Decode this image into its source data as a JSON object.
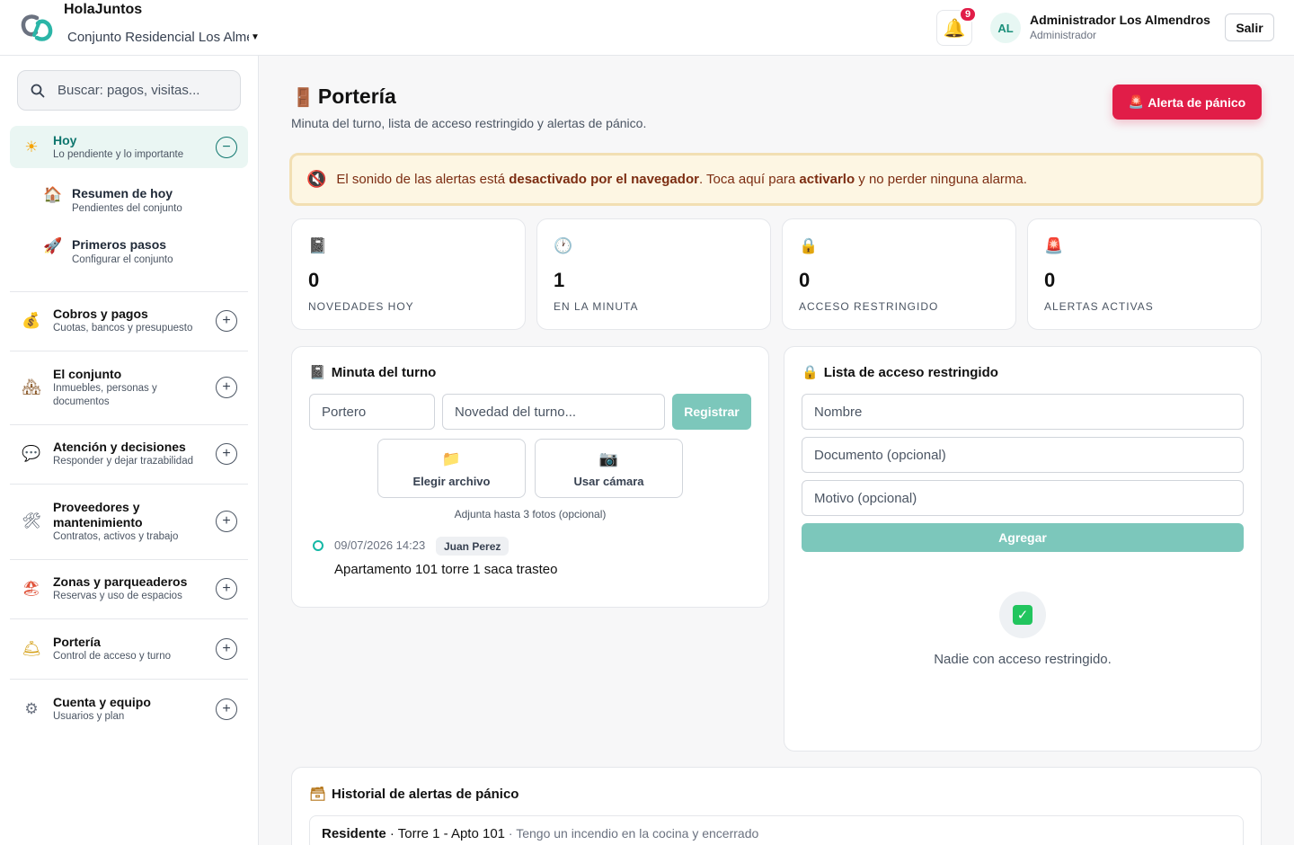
{
  "app": {
    "name": "HolaJuntos",
    "conjunto": "Conjunto Residencial Los Almendros"
  },
  "header": {
    "notifications_count": "9",
    "avatar_initials": "AL",
    "user_name": "Administrador Los Almendros",
    "user_role": "Administrador",
    "logout_label": "Salir"
  },
  "sidebar": {
    "search_placeholder": "Buscar: pagos, visitas...",
    "groups": [
      {
        "title": "Hoy",
        "subtitle": "Lo pendiente y lo importante",
        "icon": "sun-icon",
        "expanded": true,
        "items": [
          {
            "title": "Resumen de hoy",
            "subtitle": "Pendientes del conjunto",
            "icon": "house-icon"
          },
          {
            "title": "Primeros pasos",
            "subtitle": "Configurar el conjunto",
            "icon": "rocket-icon"
          }
        ]
      },
      {
        "title": "Cobros y pagos",
        "subtitle": "Cuotas, bancos y presupuesto",
        "icon": "money-bag-icon"
      },
      {
        "title": "El conjunto",
        "subtitle_1": "Inmuebles, personas y",
        "subtitle_2": "documentos",
        "icon": "houses-icon"
      },
      {
        "title": "Atención y decisiones",
        "subtitle": "Responder y dejar trazabilidad",
        "icon": "speech-bubble-icon"
      },
      {
        "title_1": "Proveedores y",
        "title_2": "mantenimiento",
        "subtitle": "Contratos, activos y trabajo",
        "icon": "tools-icon"
      },
      {
        "title": "Zonas y parqueaderos",
        "subtitle": "Reservas y uso de espacios",
        "icon": "beach-icon"
      },
      {
        "title": "Portería",
        "subtitle": "Control de acceso y turno",
        "icon": "service-bell-icon"
      },
      {
        "title": "Cuenta y equipo",
        "subtitle": "Usuarios y plan",
        "icon": "gear-icon"
      }
    ]
  },
  "main": {
    "title": "Portería",
    "subtitle": "Minuta del turno, lista de acceso restringido y alertas de pánico.",
    "panic_button": "Alerta de pánico",
    "sound_banner": {
      "part1": "El sonido de las alertas está ",
      "bold1": "desactivado por el navegador",
      "part2": ". Toca aquí para ",
      "bold2": "activarlo",
      "part3": " y no perder ninguna alarma."
    },
    "stats": [
      {
        "value": "0",
        "label": "NOVEDADES HOY",
        "icon": "logbook-icon"
      },
      {
        "value": "1",
        "label": "EN LA MINUTA",
        "icon": "clock-icon"
      },
      {
        "value": "0",
        "label": "ACCESO RESTRINGIDO",
        "icon": "lock-icon"
      },
      {
        "value": "0",
        "label": "ALERTAS ACTIVAS",
        "icon": "siren-icon"
      }
    ],
    "minuta": {
      "title": "Minuta del turno",
      "portero_placeholder": "Portero",
      "novedad_placeholder": "Novedad del turno...",
      "register_label": "Registrar",
      "choose_file_label": "Elegir archivo",
      "camera_label": "Usar cámara",
      "hint": "Adjunta hasta 3 fotos (opcional)",
      "entries": [
        {
          "datetime": "09/07/2026 14:23",
          "author": "Juan Perez",
          "text": "Apartamento 101 torre 1 saca trasteo"
        }
      ]
    },
    "restricted": {
      "title": "Lista de acceso restringido",
      "name_placeholder": "Nombre",
      "document_placeholder": "Documento (opcional)",
      "reason_placeholder": "Motivo (opcional)",
      "add_label": "Agregar",
      "empty_text": "Nadie con acceso restringido."
    },
    "history": {
      "title": "Historial de alertas de pánico",
      "rows": [
        {
          "who": "Residente",
          "location": " · Torre 1 - Apto 101",
          "message": " · Tengo un incendio en la cocina y encerrado"
        }
      ]
    }
  }
}
